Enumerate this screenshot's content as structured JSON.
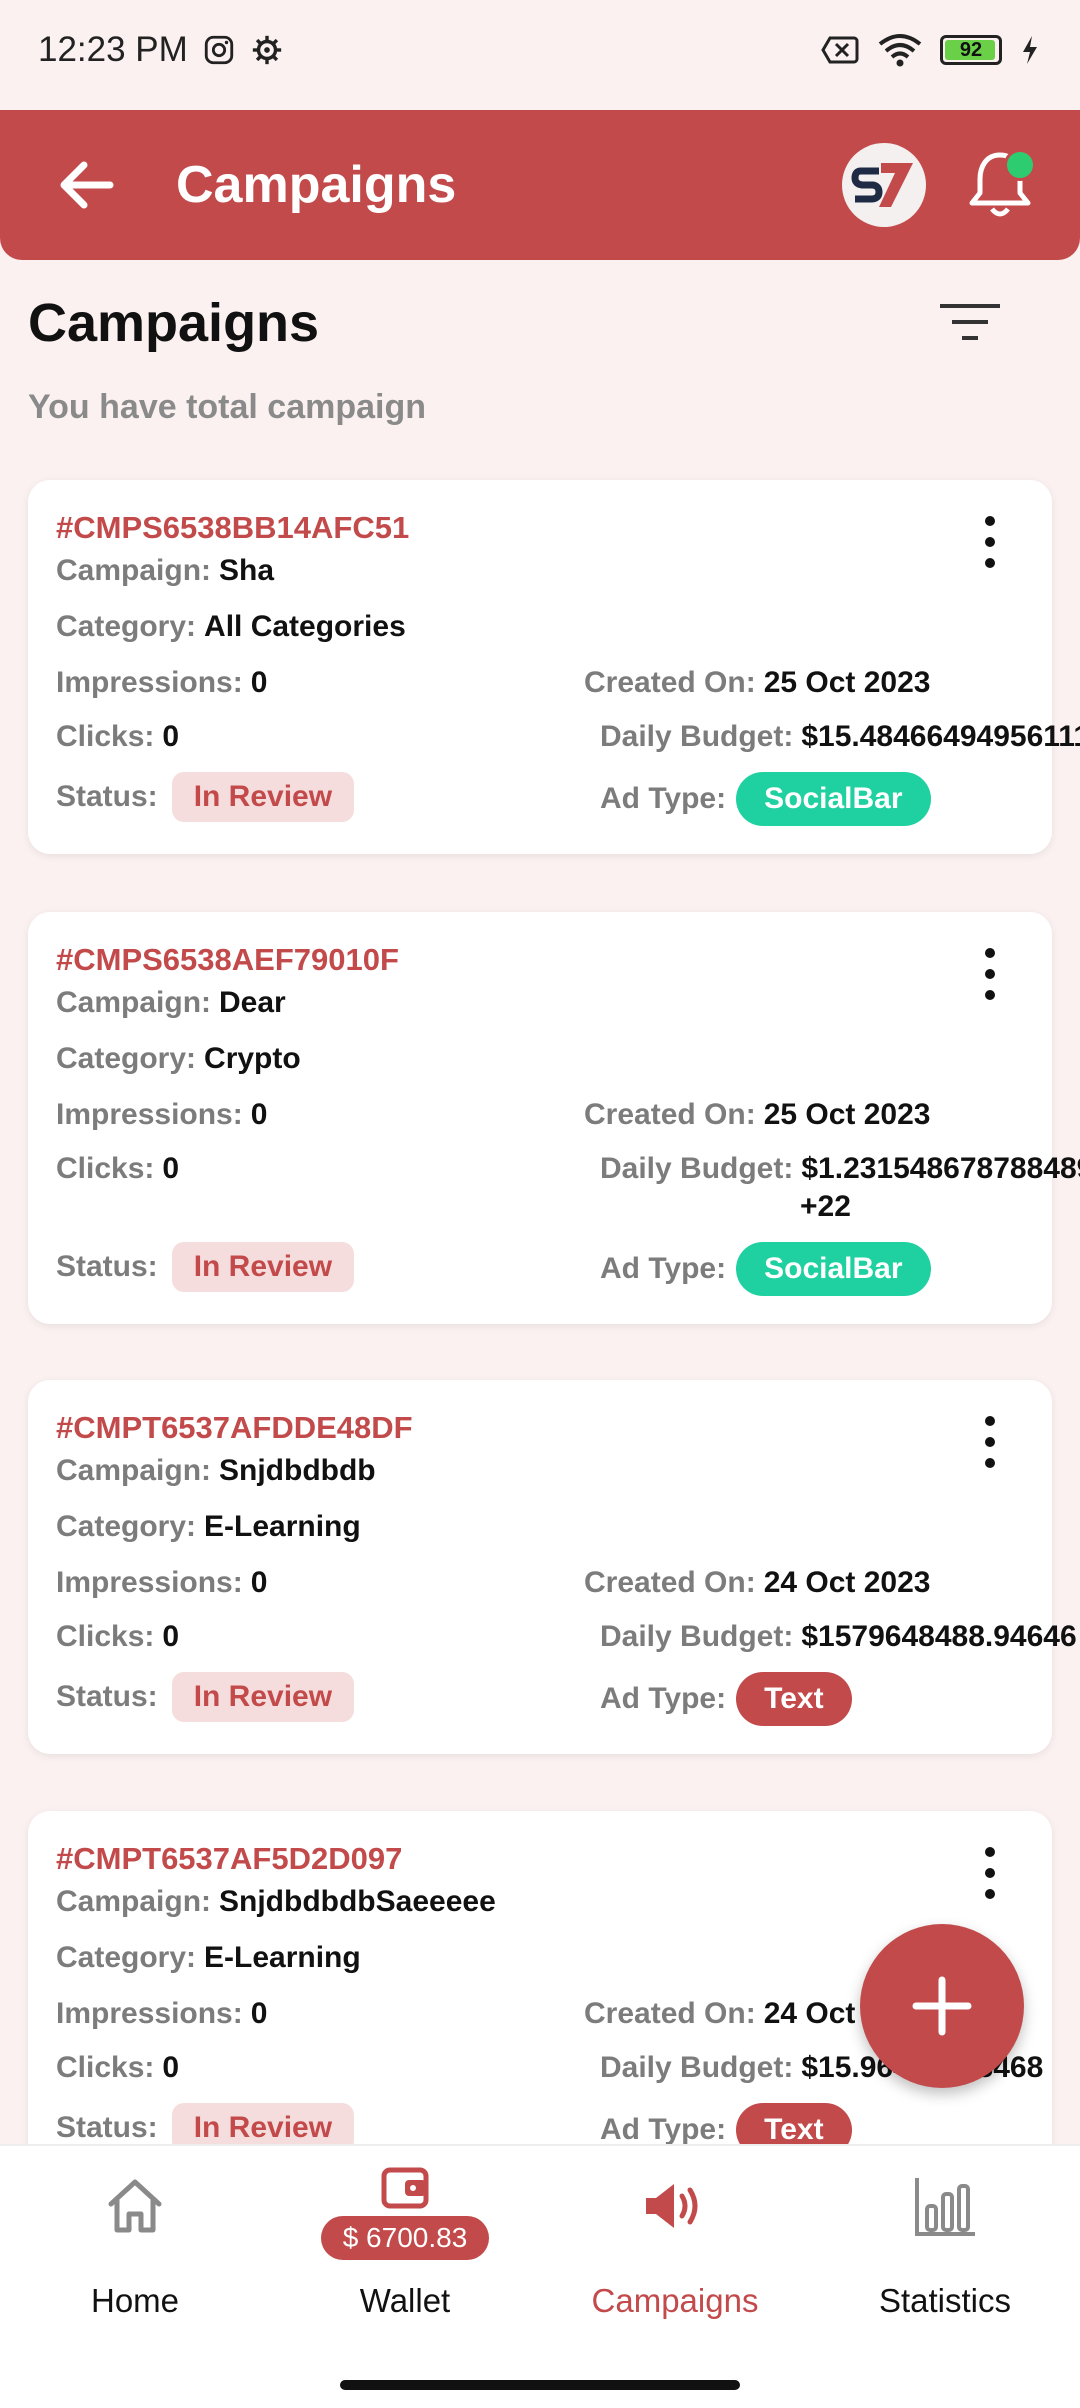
{
  "status_bar": {
    "time": "12:23 PM",
    "battery": "92"
  },
  "app_bar": {
    "title": "Campaigns"
  },
  "header": {
    "title": "Campaigns",
    "subtitle": "You have total campaign"
  },
  "labels": {
    "campaign": "Campaign:",
    "category": "Category:",
    "impressions": "Impressions:",
    "clicks": "Clicks:",
    "status": "Status:",
    "created_on": "Created On:",
    "daily_budget": "Daily Budget:",
    "ad_type": "Ad Type:"
  },
  "campaigns": [
    {
      "id": "#CMPS6538BB14AFC51",
      "name": "Sha",
      "category": "All Categories",
      "impressions": "0",
      "clicks": "0",
      "status": "In Review",
      "created_on": "25 Oct 2023",
      "daily_budget": "$15.48466494956111",
      "daily_budget_extra": "",
      "ad_type": "SocialBar"
    },
    {
      "id": "#CMPS6538AEF79010F",
      "name": "Dear",
      "category": "Crypto",
      "impressions": "0",
      "clicks": "0",
      "status": "In Review",
      "created_on": "25 Oct 2023",
      "daily_budget": "$1.231548678788489",
      "daily_budget_extra": "+22",
      "ad_type": "SocialBar"
    },
    {
      "id": "#CMPT6537AFDDE48DF",
      "name": "Snjdbdbdb",
      "category": "E-Learning",
      "impressions": "0",
      "clicks": "0",
      "status": "In Review",
      "created_on": "24 Oct 2023",
      "daily_budget": "$1579648488.94646",
      "daily_budget_extra": "",
      "ad_type": "Text"
    },
    {
      "id": "#CMPT6537AF5D2D097",
      "name": "SnjdbdbdbSaeeeee",
      "category": "E-Learning",
      "impressions": "0",
      "clicks": "0",
      "status": "In Review",
      "created_on": "24 Oct 2023",
      "daily_budget": "$15.96431518468",
      "daily_budget_extra": "",
      "ad_type": "Text"
    }
  ],
  "bottom_nav": {
    "home": "Home",
    "wallet": "Wallet",
    "wallet_balance": "$ 6700.83",
    "campaigns": "Campaigns",
    "statistics": "Statistics"
  },
  "colors": {
    "primary": "#c34a4b",
    "social_bar": "#1fd1a0",
    "status_bg": "#f6dddd",
    "background": "#fbf1f1"
  }
}
